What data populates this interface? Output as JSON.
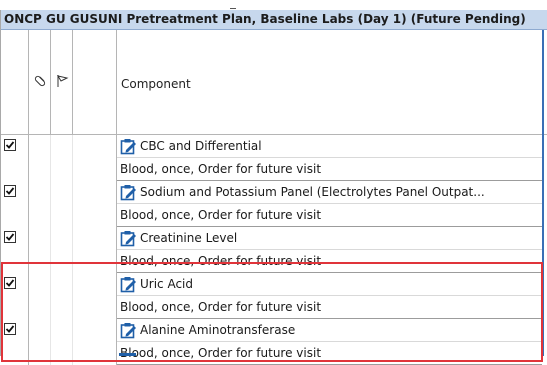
{
  "section": {
    "title": "ONCP GU GUSUNI Pretreatment Plan, Baseline Labs (Day 1) (Future Pending)"
  },
  "columns": {
    "check_icon": "checkbox",
    "pill_icon": "pill-icon",
    "flag_icon": "flag-icon",
    "component_label": "Component"
  },
  "colors": {
    "header_bg": "#c7d8ed",
    "highlight": "#e0343a",
    "icon_blue": "#1f5fa8"
  },
  "orders": [
    {
      "name": "CBC and Differential",
      "detail": "Blood, once, Order for future visit",
      "checked": true
    },
    {
      "name": "Sodium and Potassium Panel (Electrolytes Panel Outpat...",
      "detail": "Blood, once, Order for future visit",
      "checked": true
    },
    {
      "name": "Creatinine Level",
      "detail": "Blood, once, Order for future visit",
      "checked": true
    },
    {
      "name": "Uric Acid",
      "detail": "Blood, once, Order for future visit",
      "checked": true
    },
    {
      "name": "Alanine Aminotransferase",
      "detail": "Blood, once, Order for future visit",
      "checked": true
    }
  ]
}
